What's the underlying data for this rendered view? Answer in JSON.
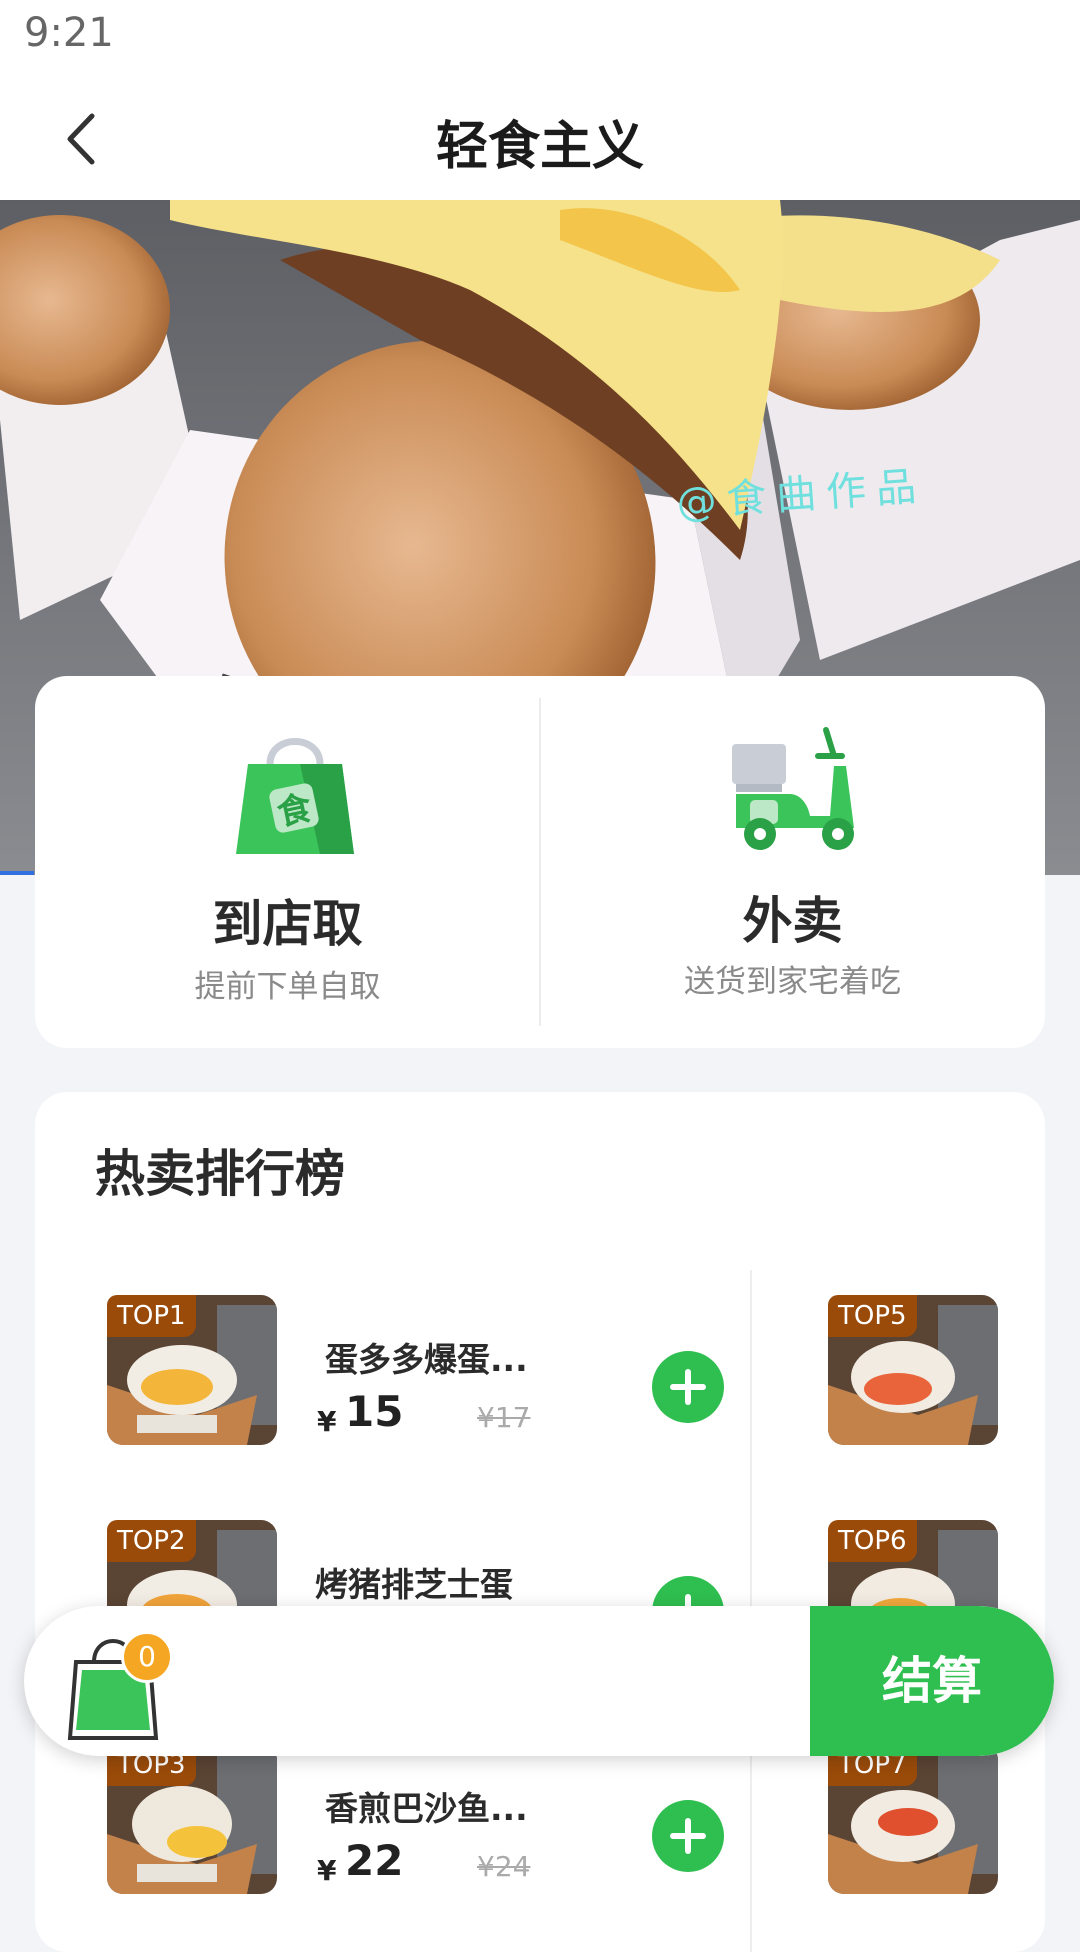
{
  "status_bar": {
    "time": "9:21"
  },
  "nav": {
    "title": "轻食主义",
    "back_icon": "chevron-left-icon"
  },
  "hero": {
    "watermark": "@食曲作品"
  },
  "service_options": [
    {
      "title": "到店取",
      "subtitle": "提前下单自取",
      "icon": "shopping-bag-icon"
    },
    {
      "title": "外卖",
      "subtitle": "送货到家宅着吃",
      "icon": "delivery-scooter-icon"
    }
  ],
  "ranking": {
    "title": "热卖排行榜",
    "items_left": [
      {
        "rank": "TOP1",
        "name": "蛋多多爆蛋...",
        "currency": "¥",
        "price": "15",
        "original_price": "¥17"
      },
      {
        "rank": "TOP2",
        "name": "烤猪排芝士蛋",
        "currency": "¥",
        "price": "",
        "original_price": ""
      },
      {
        "rank": "TOP3",
        "name": "香煎巴沙鱼...",
        "currency": "¥",
        "price": "22",
        "original_price": "¥24"
      }
    ],
    "items_right": [
      {
        "rank": "TOP5"
      },
      {
        "rank": "TOP6"
      },
      {
        "rank": "TOP7"
      }
    ]
  },
  "cart": {
    "count": "0",
    "checkout_label": "结算",
    "icon": "shopping-bag-icon"
  },
  "colors": {
    "accent_green": "#2fbe50",
    "badge_brown": "#9a4b0a",
    "count_orange": "#f5a623"
  }
}
